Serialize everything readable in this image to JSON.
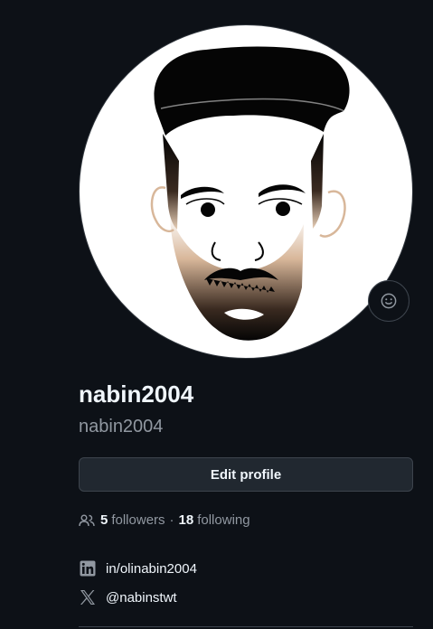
{
  "profile": {
    "fullname": "nabin2004",
    "username": "nabin2004",
    "edit_label": "Edit profile"
  },
  "stats": {
    "followers_count": "5",
    "followers_label": "followers",
    "separator": "·",
    "following_count": "18",
    "following_label": "following"
  },
  "social": {
    "linkedin": {
      "icon": "linkedin-icon",
      "text": "in/olinabin2004"
    },
    "twitter": {
      "icon": "x-icon",
      "text": "@nabinstwt"
    }
  },
  "colors": {
    "background": "#0d1117",
    "text_primary": "#f0f6fc",
    "text_muted": "#9198a1",
    "button_bg": "#212830",
    "border": "#3d444d"
  }
}
